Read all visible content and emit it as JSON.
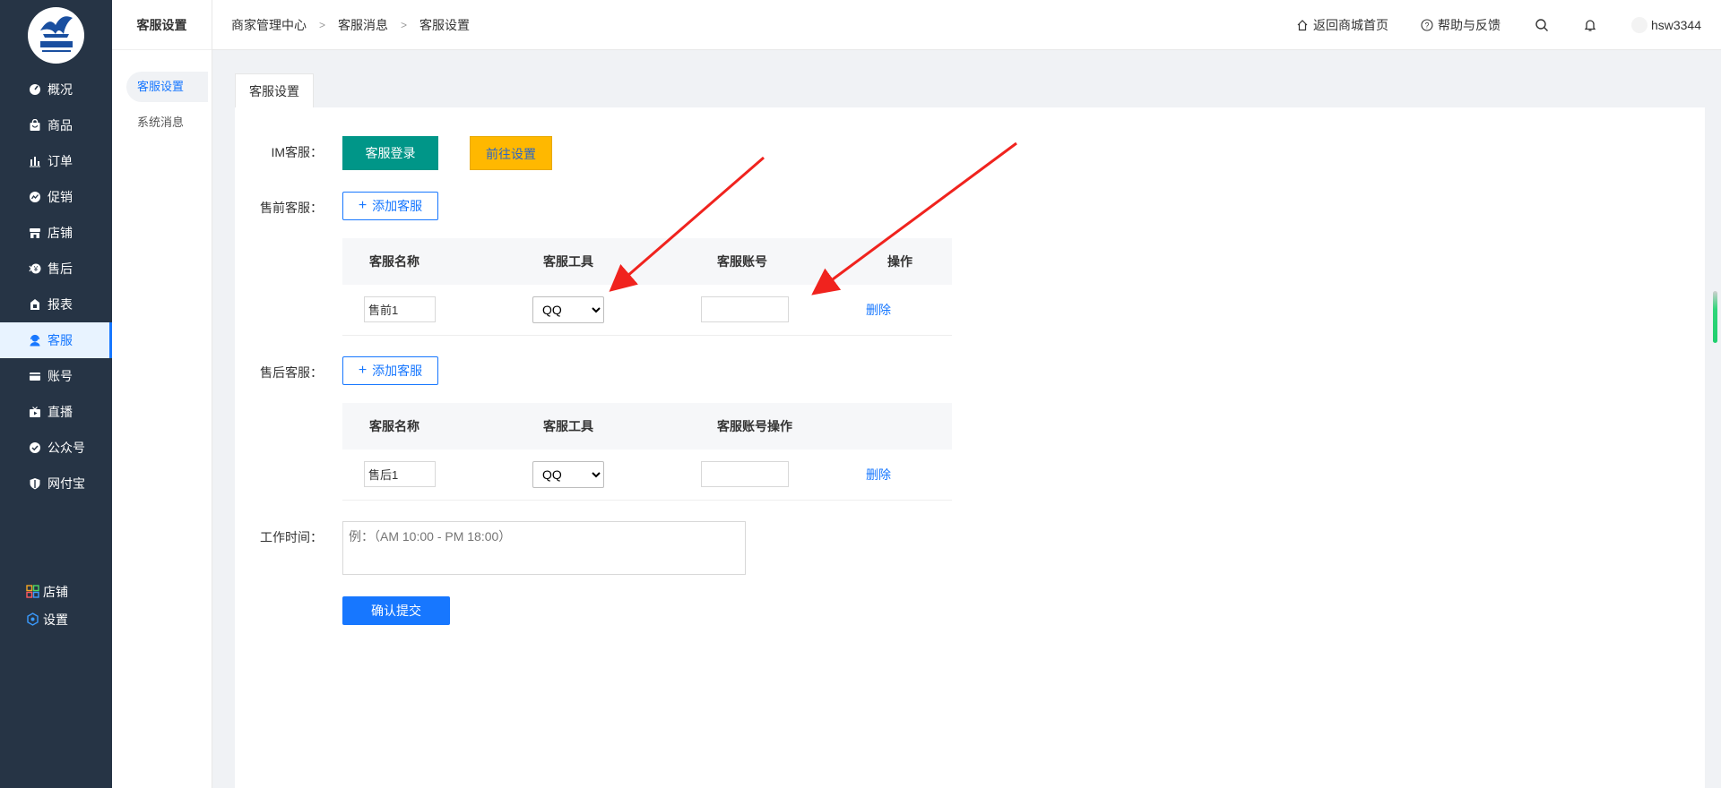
{
  "nav": {
    "items": [
      {
        "label": "概况",
        "icon": "dashboard-icon"
      },
      {
        "label": "商品",
        "icon": "bag-icon"
      },
      {
        "label": "订单",
        "icon": "bar-chart-icon"
      },
      {
        "label": "促销",
        "icon": "promotion-icon"
      },
      {
        "label": "店铺",
        "icon": "store-icon"
      },
      {
        "label": "售后",
        "icon": "after-sale-icon"
      },
      {
        "label": "报表",
        "icon": "report-icon"
      },
      {
        "label": "客服",
        "icon": "customer-service-icon"
      },
      {
        "label": "账号",
        "icon": "card-icon"
      },
      {
        "label": "直播",
        "icon": "live-icon"
      },
      {
        "label": "公众号",
        "icon": "verified-icon"
      },
      {
        "label": "网付宝",
        "icon": "shield-icon"
      }
    ],
    "active_index": 7,
    "bottom": [
      {
        "label": "店铺",
        "icon": "grid-icon"
      },
      {
        "label": "设置",
        "icon": "settings-icon"
      }
    ]
  },
  "subnav": {
    "title": "客服设置",
    "items": [
      "客服设置",
      "系统消息"
    ]
  },
  "header": {
    "breadcrumb": [
      "商家管理中心",
      "客服消息",
      "客服设置"
    ],
    "home_link": "返回商城首页",
    "help_link": "帮助与反馈",
    "username": "hsw3344"
  },
  "tab": {
    "label": "客服设置"
  },
  "form": {
    "im_label": "IM客服：",
    "login_btn": "客服登录",
    "goto_btn": "前往设置",
    "presale_label": "售前客服：",
    "aftersale_label": "售后客服：",
    "add_btn": "添加客服",
    "presale_table": {
      "headers": [
        "客服名称",
        "客服工具",
        "客服账号",
        "操作"
      ],
      "row": {
        "name": "售前1",
        "tool": "QQ",
        "account": "",
        "action": "删除"
      }
    },
    "aftersale_table": {
      "headers": [
        "客服名称",
        "客服工具",
        "客服账号操作",
        ""
      ],
      "row": {
        "name": "售后1",
        "tool": "QQ",
        "account": "",
        "action": "删除"
      }
    },
    "tool_options": [
      "QQ"
    ],
    "worktime_label": "工作时间：",
    "worktime_placeholder": "例：（AM 10:00 - PM 18:00）",
    "submit_btn": "确认提交"
  },
  "colors": {
    "nav_bg": "#263445",
    "primary": "#1777ff",
    "teal": "#009688",
    "amber": "#ffb800",
    "arrow": "#f0231e"
  }
}
